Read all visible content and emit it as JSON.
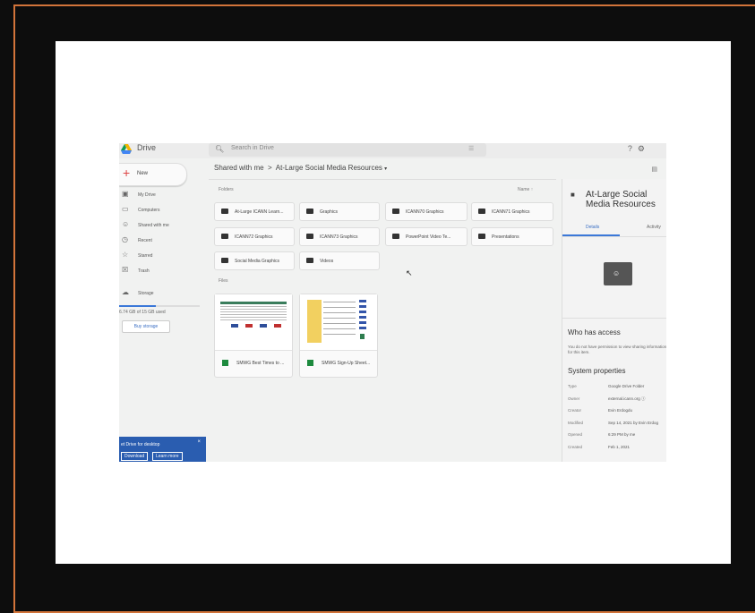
{
  "app": {
    "brand": "Drive",
    "search_placeholder": "Search in Drive"
  },
  "new_button": {
    "label": "New"
  },
  "nav": [
    {
      "icon": "my-drive-icon",
      "glyph": "▣",
      "label": "My Drive"
    },
    {
      "icon": "computer-icon",
      "glyph": "▭",
      "label": "Computers"
    },
    {
      "icon": "shared-icon",
      "glyph": "☺",
      "label": "Shared with me"
    },
    {
      "icon": "clock-icon",
      "glyph": "◷",
      "label": "Recent"
    },
    {
      "icon": "star-icon",
      "glyph": "☆",
      "label": "Starred"
    },
    {
      "icon": "trash-icon",
      "glyph": "☒",
      "label": "Trash"
    }
  ],
  "storage": {
    "label": "Storage",
    "used_text": "6.74 GB of 15 GB used",
    "used_fraction": 0.45,
    "buy_label": "Buy storage"
  },
  "promo": {
    "title": "et Drive for desktop",
    "download": "Download",
    "learn_more": "Learn more"
  },
  "breadcrumb": {
    "root": "Shared with me",
    "separator": ">",
    "current": "At-Large Social Media Resources",
    "caret": "▾"
  },
  "content": {
    "folders_label": "Folders",
    "sort_label": "Name ↑",
    "files_label": "Files"
  },
  "folders": [
    "At-Large ICANN Learn...",
    "Graphics",
    "ICANN70 Graphics",
    "ICANN71 Graphics",
    "ICANN72 Graphics",
    "ICANN73 Graphics",
    "PowerPoint Video Te...",
    "Presentations",
    "Social Media Graphics",
    "Videos"
  ],
  "files": [
    "SMWG Best Times to ...",
    "SMWG Sign-Up Sheet..."
  ],
  "details": {
    "title_line1": "At-Large Social",
    "title_line2": "Media Resources",
    "tab_details": "Details",
    "tab_activity": "Activity",
    "who_has_access": "Who has access",
    "no_permission": "You do not have permission to view sharing information for this item.",
    "system_properties": "System properties",
    "properties": [
      {
        "key": "Type",
        "value": "Google Drive Folder"
      },
      {
        "key": "Owner",
        "value": "external.icann.org ⓘ"
      },
      {
        "key": "Creator",
        "value": "Evin Erdogdu"
      },
      {
        "key": "Modified",
        "value": "Sep 14, 2021 by Evin Erdog"
      },
      {
        "key": "Opened",
        "value": "6:29 PM by me"
      },
      {
        "key": "Created",
        "value": "Feb 1, 2021"
      }
    ]
  },
  "colors": {
    "frame": "#d2743a",
    "accent": "#3b78d8",
    "sheets_green": "#1d8a3e"
  }
}
